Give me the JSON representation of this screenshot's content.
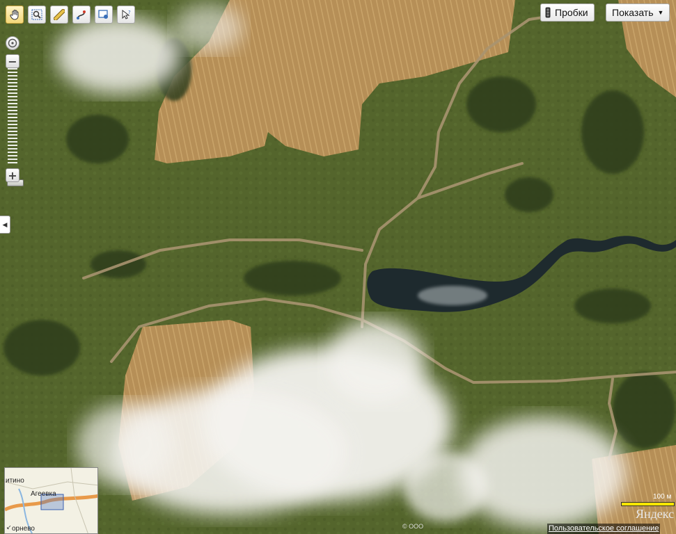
{
  "toolbar": {
    "tools": [
      "hand-icon",
      "zoom-area-icon",
      "ruler-icon",
      "route-icon",
      "layers-icon",
      "select-icon"
    ]
  },
  "zoom": {
    "plus": "+",
    "minus": "−"
  },
  "top_buttons": {
    "traffic_label": "Пробки",
    "show_label": "Показать"
  },
  "minimap": {
    "labels": [
      "итино",
      "Агеевка",
      "орнево"
    ]
  },
  "scale": {
    "label": "100 м"
  },
  "footer": {
    "logo": "Яндекс",
    "copyright": "© ООО",
    "agreement": "Пользовательское соглашение"
  }
}
